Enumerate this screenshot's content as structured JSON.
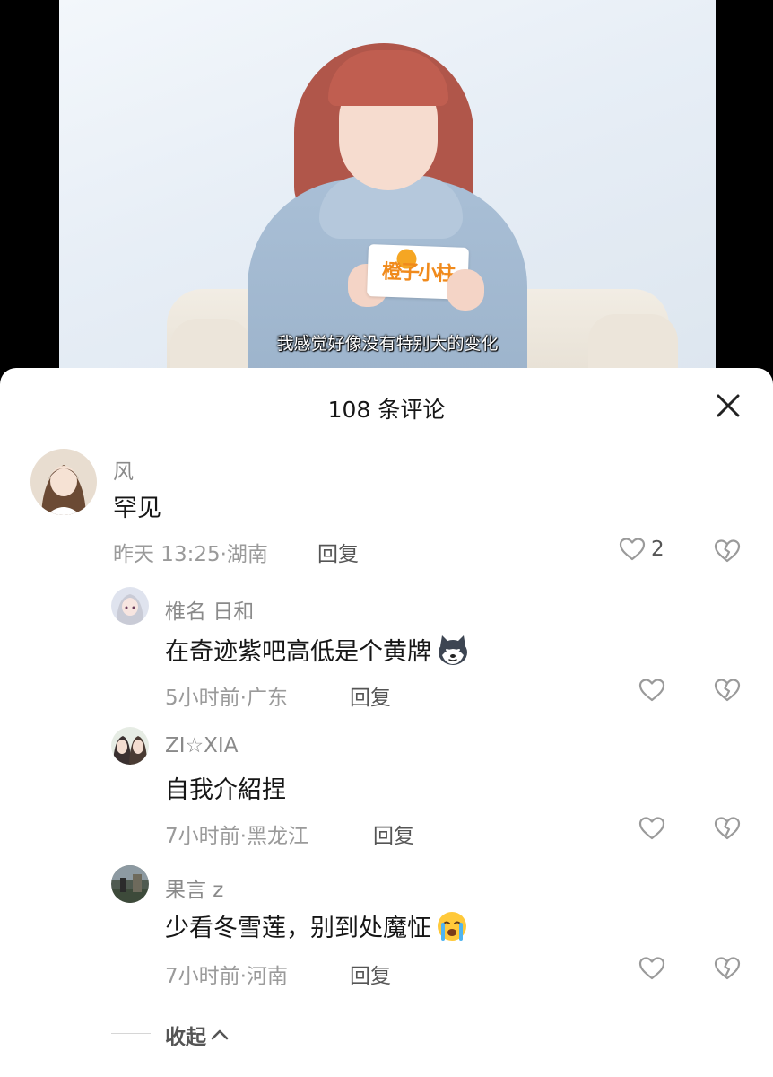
{
  "video": {
    "subtitle": "我感觉好像没有特别大的变化",
    "card_logo": "橙子小柱"
  },
  "comments_header": {
    "title": "108 条评论"
  },
  "comments": [
    {
      "username": "风",
      "text": "罕见",
      "meta": "昨天 13:25·湖南",
      "reply_label": "回复",
      "like_count": "2"
    }
  ],
  "replies": [
    {
      "username": "椎名 日和",
      "text": "在奇迹紫吧高低是个黄牌",
      "emoji": "husky-dog-emoji",
      "meta": "5小时前·广东",
      "reply_label": "回复"
    },
    {
      "username": "ZI☆XIA",
      "text": "自我介紹捏",
      "meta": "7小时前·黑龙江",
      "reply_label": "回复"
    },
    {
      "username": "果言 z",
      "text": "少看冬雪莲，别到处魔怔",
      "emoji": "crying-face-emoji",
      "meta": "7小时前·河南",
      "reply_label": "回复"
    }
  ],
  "collapse_label": "收起",
  "colors": {
    "sheet_bg": "#ffffff",
    "text_primary": "#161616",
    "text_secondary": "#9a9a9a",
    "icon_gray": "#9a9a9a"
  }
}
